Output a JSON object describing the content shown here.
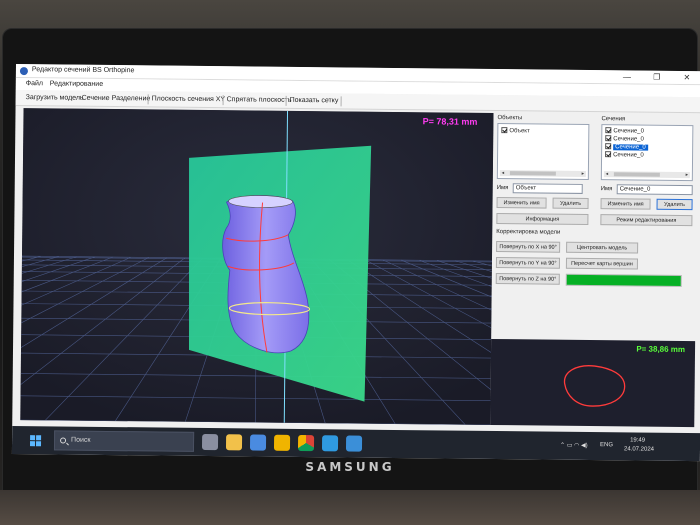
{
  "window": {
    "title": "Редактор сечений BS Orthopine",
    "controls": [
      "—",
      "❐",
      "✕"
    ]
  },
  "menu": [
    "Файл",
    "Редактирование"
  ],
  "toolbar": [
    "Загрузить модель",
    "Сечение",
    "Разделение",
    "Плоскость сечения XY",
    "Спрятать плоскость",
    "Показать сетку"
  ],
  "viewport": {
    "readout": "P= 78,31 mm"
  },
  "objects_panel": {
    "title": "Объекты",
    "items": [
      {
        "label": "Объект",
        "checked": true
      }
    ],
    "name_label": "Имя",
    "name_value": "Объект",
    "rename_button": "Изменить имя",
    "delete_button": "Удалить",
    "info_button": "Информация"
  },
  "sections_panel": {
    "title": "Сечения",
    "items": [
      {
        "label": "Сечение_0",
        "checked": true,
        "selected": false
      },
      {
        "label": "Сечение_0",
        "checked": true,
        "selected": false
      },
      {
        "label": "Сечение_0",
        "checked": true,
        "selected": true
      },
      {
        "label": "Сечение_0",
        "checked": true,
        "selected": false
      }
    ],
    "name_label": "Имя",
    "name_value": "Сечение_0",
    "rename_button": "Изменить имя",
    "delete_button": "Удалить",
    "edit_mode_button": "Режим редактирования"
  },
  "model_correction": {
    "title": "Корректировка модели",
    "rotate_x": "Повернуть по X на 90°",
    "rotate_y": "Повернуть по Y на 90°",
    "rotate_z": "Повернуть по Z на 90°",
    "center_model": "Центровать модель",
    "recalc_vertex_map": "Пересчет карты вершин",
    "progress": 1.0,
    "progress_color": "#06b025"
  },
  "section_view": {
    "readout": "P= 38,86 mm"
  },
  "taskbar": {
    "search_placeholder": "Поиск",
    "language": "ENG",
    "time": "19:49",
    "date": "24.07.2024",
    "icons": [
      "start-icon",
      "search-icon",
      "file-explorer-icon",
      "mail-icon",
      "chrome-icon",
      "edge-icon",
      "security-icon"
    ]
  },
  "device": {
    "brand": "SAMSUNG"
  },
  "colors": {
    "viewport_bg": "#1e1f2d",
    "section_plane": "#2fd08e",
    "model": "#8a7df0",
    "section_curve": "#ff3b3b",
    "readout_main": "#ff3cf0",
    "readout_section": "#59ff3a"
  }
}
